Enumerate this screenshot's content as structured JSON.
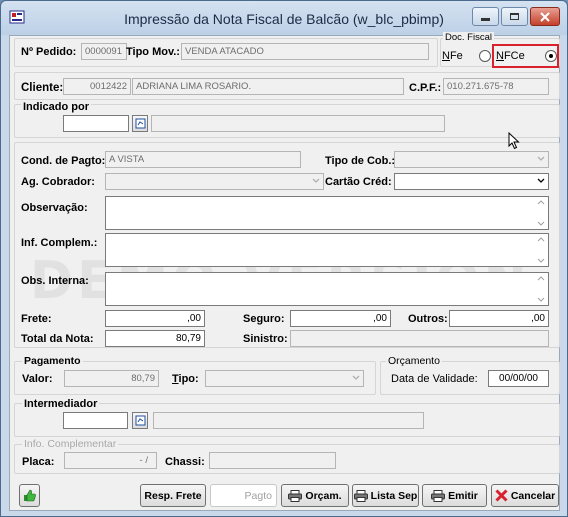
{
  "window": {
    "title": "Impressão da Nota Fiscal de Balcão (w_blc_pbimp)"
  },
  "header": {
    "pedido_label": "Nº Pedido:",
    "pedido_value": "0000091",
    "tipo_mov_label": "Tipo Mov.:",
    "tipo_mov_value": "VENDA ATACADO",
    "doc_fiscal_label": "Doc. Fiscal",
    "nfe_label": "NFe",
    "nfce_label": "NFCe"
  },
  "cliente": {
    "label": "Cliente:",
    "code": "0012422",
    "name": "ADRIANA LIMA ROSARIO.",
    "cpf_label": "C.P.F.:",
    "cpf_value": "010.271.675-78"
  },
  "indicado": {
    "label": "Indicado por",
    "code": "",
    "name": ""
  },
  "payment_form": {
    "cond_pagto_label": "Cond. de Pagto:",
    "cond_pagto_value": "A VISTA",
    "tipo_cob_label": "Tipo de Cob.:",
    "tipo_cob_value": "",
    "ag_cobrador_label": "Ag. Cobrador:",
    "ag_cobrador_value": "",
    "cartao_label": "Cartão Créd:",
    "cartao_value": "",
    "observacao_label": "Observação:",
    "inf_complem_label": "Inf. Complem.:",
    "obs_interna_label": "Obs. Interna:"
  },
  "totals": {
    "frete_label": "Frete:",
    "frete_value": ",00",
    "seguro_label": "Seguro:",
    "seguro_value": ",00",
    "outros_label": "Outros:",
    "outros_value": ",00",
    "total_label": "Total da Nota:",
    "total_value": "80,79",
    "sinistro_label": "Sinistro:",
    "sinistro_value": ""
  },
  "pagamento": {
    "title": "Pagamento",
    "valor_label": "Valor:",
    "valor_value": "80,79",
    "tipo_label": "Tipo:",
    "tipo_value": ""
  },
  "orcamento": {
    "title": "Orçamento",
    "validade_label": "Data de Validade:",
    "validade_value": "00/00/00"
  },
  "intermediador": {
    "label": "Intermediador",
    "code": "",
    "name": ""
  },
  "info_complementar": {
    "title": "Info. Complementar",
    "placa_label": "Placa:",
    "placa_value": "- /",
    "chassi_label": "Chassi:",
    "chassi_value": ""
  },
  "buttons": {
    "resp_frete": "Resp. Frete",
    "pagto": "Pagto",
    "orcam": "Orçam.",
    "lista_sep": "Lista Sep",
    "emitir": "Emitir",
    "cancelar": "Cancelar"
  },
  "watermark": "DEMO VERSION",
  "colors": {
    "accent_red": "#d9202c",
    "window_frame": "#c9d9ea",
    "client_bg": "#f0f0f0"
  }
}
